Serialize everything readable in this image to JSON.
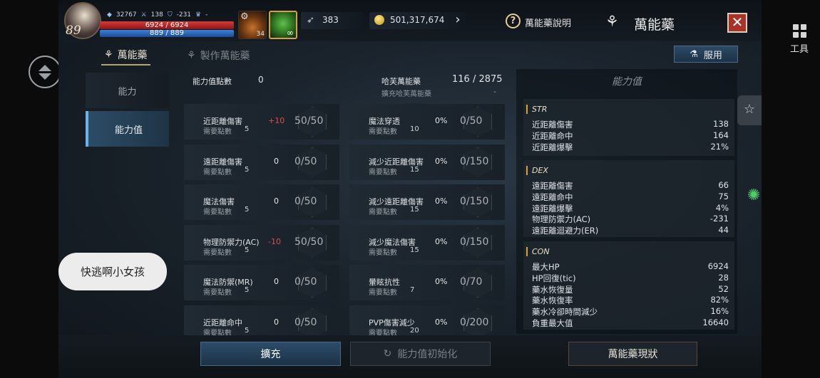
{
  "player": {
    "level": "89",
    "power": "32767",
    "attack": "138",
    "defense": "-231",
    "trophy": "-",
    "hp": "6924 / 6924",
    "mp": "889 / 889"
  },
  "items": {
    "potion_count": "34",
    "elixir_label": "∞"
  },
  "currency": {
    "feathers": "383",
    "gold": "501,317,674"
  },
  "header": {
    "help_label": "萬能藥說明",
    "title": "萬能藥"
  },
  "tabs": [
    {
      "label": "萬能藥"
    },
    {
      "label": "製作萬能藥"
    }
  ],
  "take_button": "服用",
  "nav": [
    {
      "label": "能力"
    },
    {
      "label": "能力值"
    }
  ],
  "mid": {
    "points_label": "能力值點數",
    "points_value": "0",
    "halfaran_label": "哈芙萬能藥",
    "halfaran_sub": "擴充哈芙萬能藥",
    "halfaran_value": "116 / 2875",
    "halfaran_sub_value": "-",
    "need_label": "需要點數"
  },
  "left_cells": [
    {
      "name": "近距離傷害",
      "need": "5",
      "bonus": "+10",
      "progress": "50/50"
    },
    {
      "name": "遠距離傷害",
      "need": "5",
      "bonus": "0",
      "progress": "0/50"
    },
    {
      "name": "魔法傷害",
      "need": "5",
      "bonus": "0",
      "progress": "0/50"
    },
    {
      "name": "物理防禦力(AC)",
      "need": "5",
      "bonus": "-10",
      "progress": "50/50"
    },
    {
      "name": "魔法防禦(MR)",
      "need": "5",
      "bonus": "0",
      "progress": "0/50"
    },
    {
      "name": "近距離命中",
      "need": "5",
      "bonus": "0",
      "progress": "0/50"
    }
  ],
  "right_cells": [
    {
      "name": "魔法穿透",
      "need": "10",
      "bonus": "0%",
      "progress": "0/50"
    },
    {
      "name": "減少近距離傷害",
      "need": "15",
      "bonus": "0%",
      "progress": "0/150"
    },
    {
      "name": "減少遠距離傷害",
      "need": "15",
      "bonus": "0%",
      "progress": "0/150"
    },
    {
      "name": "減少魔法傷害",
      "need": "15",
      "bonus": "0%",
      "progress": "0/150"
    },
    {
      "name": "暈眩抗性",
      "need": "7",
      "bonus": "0%",
      "progress": "0/70"
    },
    {
      "name": "PVP傷害減少",
      "need": "20",
      "bonus": "0%",
      "progress": "0/200"
    }
  ],
  "stats_panel": {
    "title": "能力值",
    "sections": [
      {
        "header": "STR",
        "rows": [
          {
            "label": "近距離傷害",
            "value": "138"
          },
          {
            "label": "近距離命中",
            "value": "164"
          },
          {
            "label": "近距離爆擊",
            "value": "21%"
          }
        ]
      },
      {
        "header": "DEX",
        "rows": [
          {
            "label": "遠距離傷害",
            "value": "66"
          },
          {
            "label": "遠距離命中",
            "value": "75"
          },
          {
            "label": "遠距離爆擊",
            "value": "4%"
          },
          {
            "label": "物理防禦力(AC)",
            "value": "-231"
          },
          {
            "label": "遠距離迴避力(ER)",
            "value": "44"
          }
        ]
      },
      {
        "header": "CON",
        "rows": [
          {
            "label": "最大HP",
            "value": "6924"
          },
          {
            "label": "HP回復(tic)",
            "value": "28"
          },
          {
            "label": "藥水恢復量",
            "value": "52"
          },
          {
            "label": "藥水恢復率",
            "value": "82%"
          },
          {
            "label": "藥水冷卻時間減少",
            "value": "16%"
          },
          {
            "label": "負重最大值",
            "value": "16640"
          }
        ]
      }
    ]
  },
  "bottom": {
    "expand": "擴充",
    "reset": "能力值初始化",
    "status": "萬能藥現狀"
  },
  "overlay": {
    "chat_text": "快逃啊小女孩",
    "tool_label": "工具"
  },
  "colors": {
    "bonus_positive": "#e24a4a",
    "bonus_neutral": "#e6e6e6",
    "accent_blue": "#6fb2e8",
    "accent_gold": "#d6a23a"
  }
}
